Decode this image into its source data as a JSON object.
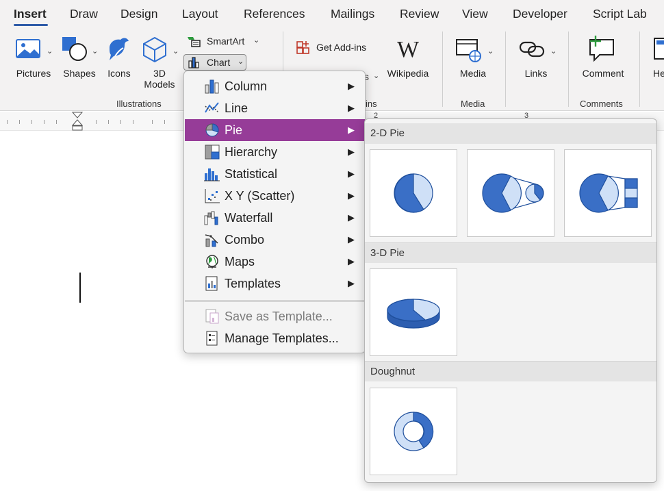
{
  "tabs": [
    "Insert",
    "Draw",
    "Design",
    "Layout",
    "References",
    "Mailings",
    "Review",
    "View",
    "Developer",
    "Script Lab"
  ],
  "ribbon": {
    "pictures": "Pictures",
    "shapes": "Shapes",
    "icons": "Icons",
    "models_line1": "3D",
    "models_line2": "Models",
    "smartart": "SmartArt",
    "chart": "Chart",
    "get_addins": "Get Add-ins",
    "wikipedia": "Wikipedia",
    "media": "Media",
    "links": "Links",
    "comment": "Comment",
    "header_partial": "He",
    "group_illustrations": "Illustrations",
    "group_addins_partial": "ins",
    "group_media": "Media",
    "group_comments": "Comments",
    "hidden_partial": "s"
  },
  "ruler": {
    "n2": "2",
    "n3": "3"
  },
  "chart_menu": {
    "items": [
      {
        "label": "Column",
        "icon": "column-chart-icon"
      },
      {
        "label": "Line",
        "icon": "line-chart-icon"
      },
      {
        "label": "Pie",
        "icon": "pie-chart-icon"
      },
      {
        "label": "Hierarchy",
        "icon": "hierarchy-chart-icon"
      },
      {
        "label": "Statistical",
        "icon": "statistical-chart-icon"
      },
      {
        "label": "X Y (Scatter)",
        "icon": "scatter-chart-icon"
      },
      {
        "label": "Waterfall",
        "icon": "waterfall-chart-icon"
      },
      {
        "label": "Combo",
        "icon": "combo-chart-icon"
      },
      {
        "label": "Maps",
        "icon": "maps-chart-icon"
      },
      {
        "label": "Templates",
        "icon": "templates-icon"
      }
    ],
    "save_template": "Save as Template...",
    "manage_templates": "Manage Templates...",
    "selected": "Pie",
    "selected_color": "#963c98"
  },
  "pie_submenu": {
    "sections": [
      "2-D Pie",
      "3-D Pie",
      "Doughnut"
    ]
  },
  "colors": {
    "accent_blue": "#3a6fc6",
    "light_blue": "#cfe0f7",
    "tab_underline": "#2f5ca8"
  }
}
